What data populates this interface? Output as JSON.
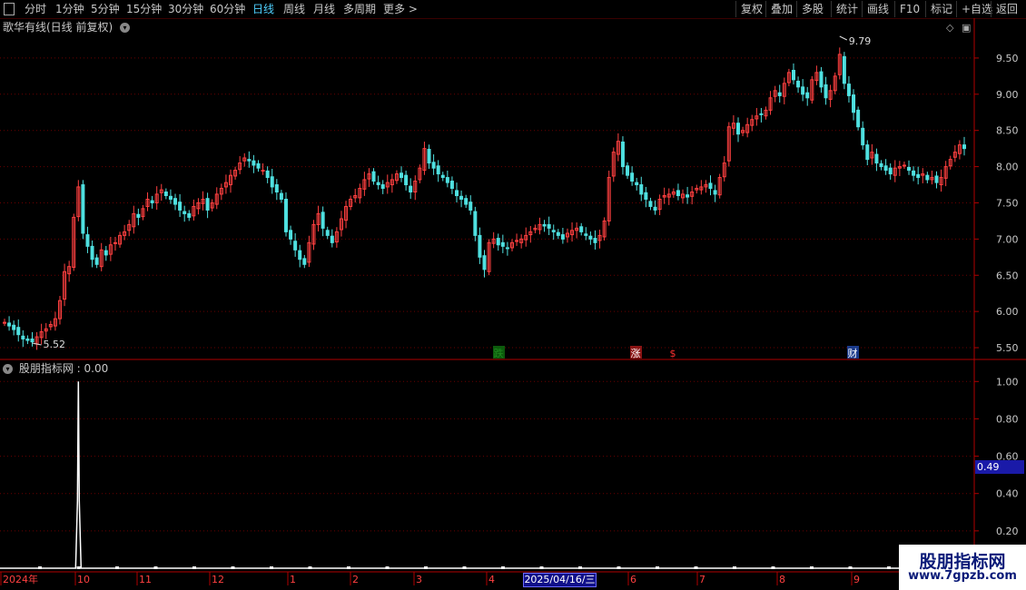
{
  "toolbar": {
    "periods": [
      "分时",
      "1分钟",
      "5分钟",
      "15分钟",
      "30分钟",
      "60分钟",
      "日线",
      "周线",
      "月线",
      "多周期",
      "更多 >"
    ],
    "active_index": 6,
    "right_buttons": [
      "复权",
      "叠加",
      "多股",
      "统计",
      "画线",
      "F10",
      "标记",
      "+自选",
      "返回"
    ]
  },
  "main_panel": {
    "title": "歌华有线(日线 前复权)",
    "y_ticks": [
      "9.50",
      "9.00",
      "8.50",
      "8.00",
      "7.50",
      "7.00",
      "6.50",
      "6.00",
      "5.50"
    ],
    "high_label": "9.79",
    "low_label": "5.52",
    "markers": [
      {
        "text": "跌",
        "color": "#1f8a1f",
        "bg": "#0c5a0c"
      },
      {
        "text": "涨",
        "color": "#ffffff",
        "bg": "#8a1414"
      },
      {
        "text": "$",
        "color": "#ff3030",
        "bg": ""
      },
      {
        "text": "财",
        "color": "#ffffff",
        "bg": "#1a3a8a"
      }
    ]
  },
  "indicator_panel": {
    "title": "股朋指标网 : 0.00",
    "y_ticks": [
      "1.00",
      "0.80",
      "0.60",
      "0.40",
      "0.20"
    ],
    "current_value": "0.49"
  },
  "x_axis": {
    "labels": [
      "2024年",
      "10",
      "11",
      "12",
      "1",
      "2",
      "3",
      "4",
      "6",
      "7",
      "8",
      "9"
    ],
    "cursor_date": "2025/04/16/三"
  },
  "watermark": {
    "line1": "股朋指标网",
    "line2": "www.7gpzb.com"
  },
  "colors": {
    "up": "#ff4040",
    "down": "#4fe0e0",
    "grid": "#6a0000",
    "axis": "#b00000",
    "indicator": "#ffffff"
  },
  "chart_data": {
    "type": "candlestick",
    "ylim": [
      5.35,
      9.85
    ],
    "closes": [
      5.85,
      5.8,
      5.75,
      5.68,
      5.62,
      5.6,
      5.58,
      5.65,
      5.72,
      5.76,
      5.82,
      5.9,
      6.15,
      6.55,
      6.62,
      7.3,
      7.72,
      7.08,
      6.9,
      6.72,
      6.65,
      6.85,
      6.78,
      6.92,
      6.95,
      7.05,
      7.1,
      7.2,
      7.35,
      7.3,
      7.42,
      7.55,
      7.5,
      7.62,
      7.68,
      7.6,
      7.55,
      7.48,
      7.4,
      7.35,
      7.3,
      7.45,
      7.5,
      7.55,
      7.4,
      7.5,
      7.62,
      7.7,
      7.78,
      7.88,
      7.95,
      8.05,
      8.12,
      8.08,
      8.02,
      7.98,
      7.95,
      7.85,
      7.72,
      7.65,
      7.55,
      7.1,
      7.0,
      6.85,
      6.72,
      6.65,
      6.95,
      7.2,
      7.35,
      7.15,
      7.05,
      6.95,
      7.1,
      7.28,
      7.45,
      7.55,
      7.6,
      7.7,
      7.82,
      7.9,
      7.8,
      7.75,
      7.7,
      7.78,
      7.82,
      7.9,
      7.85,
      7.75,
      7.65,
      7.8,
      7.98,
      8.25,
      8.05,
      7.98,
      7.9,
      7.85,
      7.78,
      7.7,
      7.6,
      7.55,
      7.48,
      7.4,
      7.05,
      6.75,
      6.58,
      6.95,
      7.0,
      6.92,
      6.9,
      6.88,
      6.95,
      6.98,
      7.0,
      7.05,
      7.1,
      7.15,
      7.2,
      7.18,
      7.15,
      7.1,
      7.05,
      7.0,
      7.08,
      7.12,
      7.15,
      7.1,
      7.05,
      7.0,
      6.95,
      7.05,
      7.25,
      7.85,
      8.2,
      8.35,
      8.0,
      7.88,
      7.8,
      7.75,
      7.62,
      7.55,
      7.45,
      7.4,
      7.55,
      7.6,
      7.62,
      7.65,
      7.6,
      7.62,
      7.58,
      7.65,
      7.7,
      7.72,
      7.75,
      7.7,
      7.62,
      7.85,
      8.05,
      8.55,
      8.6,
      8.45,
      8.5,
      8.58,
      8.65,
      8.7,
      8.72,
      8.78,
      8.95,
      9.05,
      8.98,
      9.15,
      9.3,
      9.2,
      9.1,
      9.0,
      8.95,
      9.2,
      9.3,
      9.1,
      8.95,
      9.05,
      9.25,
      9.55,
      9.15,
      8.98,
      8.75,
      8.55,
      8.3,
      8.1,
      8.2,
      8.05,
      8.0,
      7.95,
      7.9,
      7.98,
      8.0,
      8.02,
      7.95,
      7.88,
      7.85,
      7.9,
      7.82,
      7.85,
      7.78,
      7.85,
      8.0,
      8.1,
      8.2,
      8.3,
      8.25
    ],
    "indicator": {
      "spike_index": 16,
      "spike_value": 1.0,
      "ylim": [
        0,
        1.05
      ]
    }
  }
}
